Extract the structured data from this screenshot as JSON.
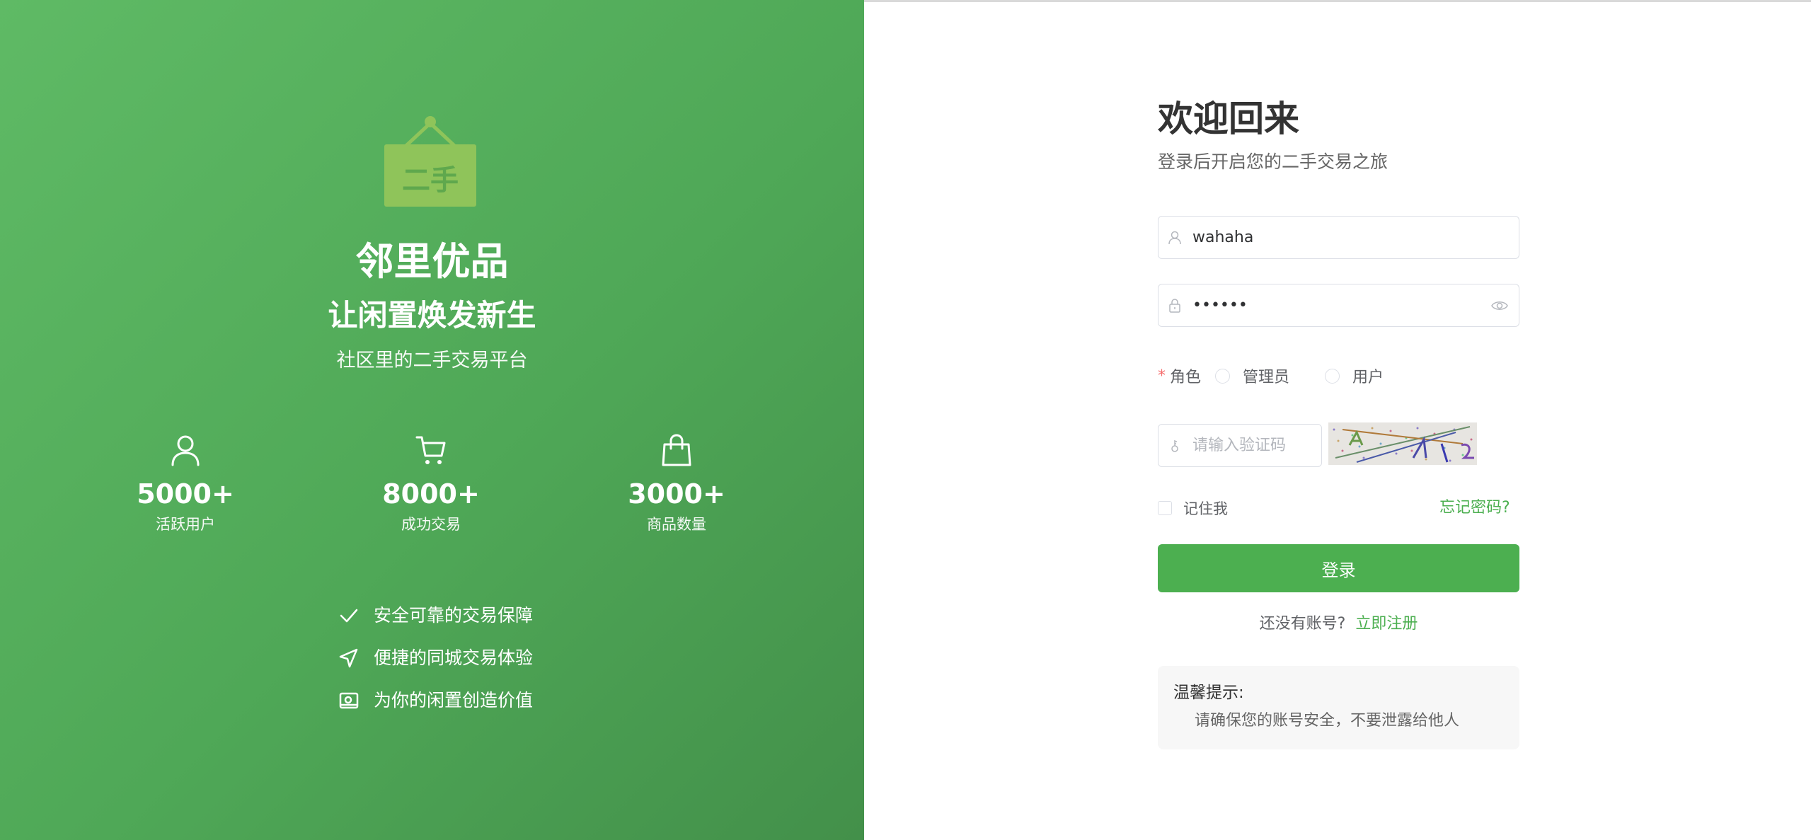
{
  "brand": {
    "logo_text": "二手",
    "title": "邻里优品",
    "slogan": "让闲置焕发新生",
    "description": "社区里的二手交易平台"
  },
  "stats": [
    {
      "icon": "user-icon",
      "value": "5000+",
      "label": "活跃用户"
    },
    {
      "icon": "cart-icon",
      "value": "8000+",
      "label": "成功交易"
    },
    {
      "icon": "shopping-bag-icon",
      "value": "3000+",
      "label": "商品数量"
    }
  ],
  "features": [
    {
      "icon": "check-icon",
      "text": "安全可靠的交易保障"
    },
    {
      "icon": "send-icon",
      "text": "便捷的同城交易体验"
    },
    {
      "icon": "wallet-icon",
      "text": "为你的闲置创造价值"
    }
  ],
  "login": {
    "title": "欢迎回来",
    "subtitle": "登录后开启您的二手交易之旅",
    "username_value": "wahaha",
    "password_value": "••••••",
    "role_label": "角色",
    "role_required_mark": "*",
    "role_options": [
      "管理员",
      "用户"
    ],
    "captcha_placeholder": "请输入验证码",
    "remember_label": "记住我",
    "forgot_label": "忘记密码?",
    "submit_label": "登录",
    "register_prompt": "还没有账号?",
    "register_link": "立即注册"
  },
  "tip": {
    "title": "温馨提示:",
    "body": "请确保您的账号安全，不要泄露给他人"
  },
  "colors": {
    "primary": "#4caf50",
    "panel_start": "#5fba65",
    "panel_end": "#43904a",
    "text_dark": "#333333",
    "text_muted": "#666666"
  }
}
